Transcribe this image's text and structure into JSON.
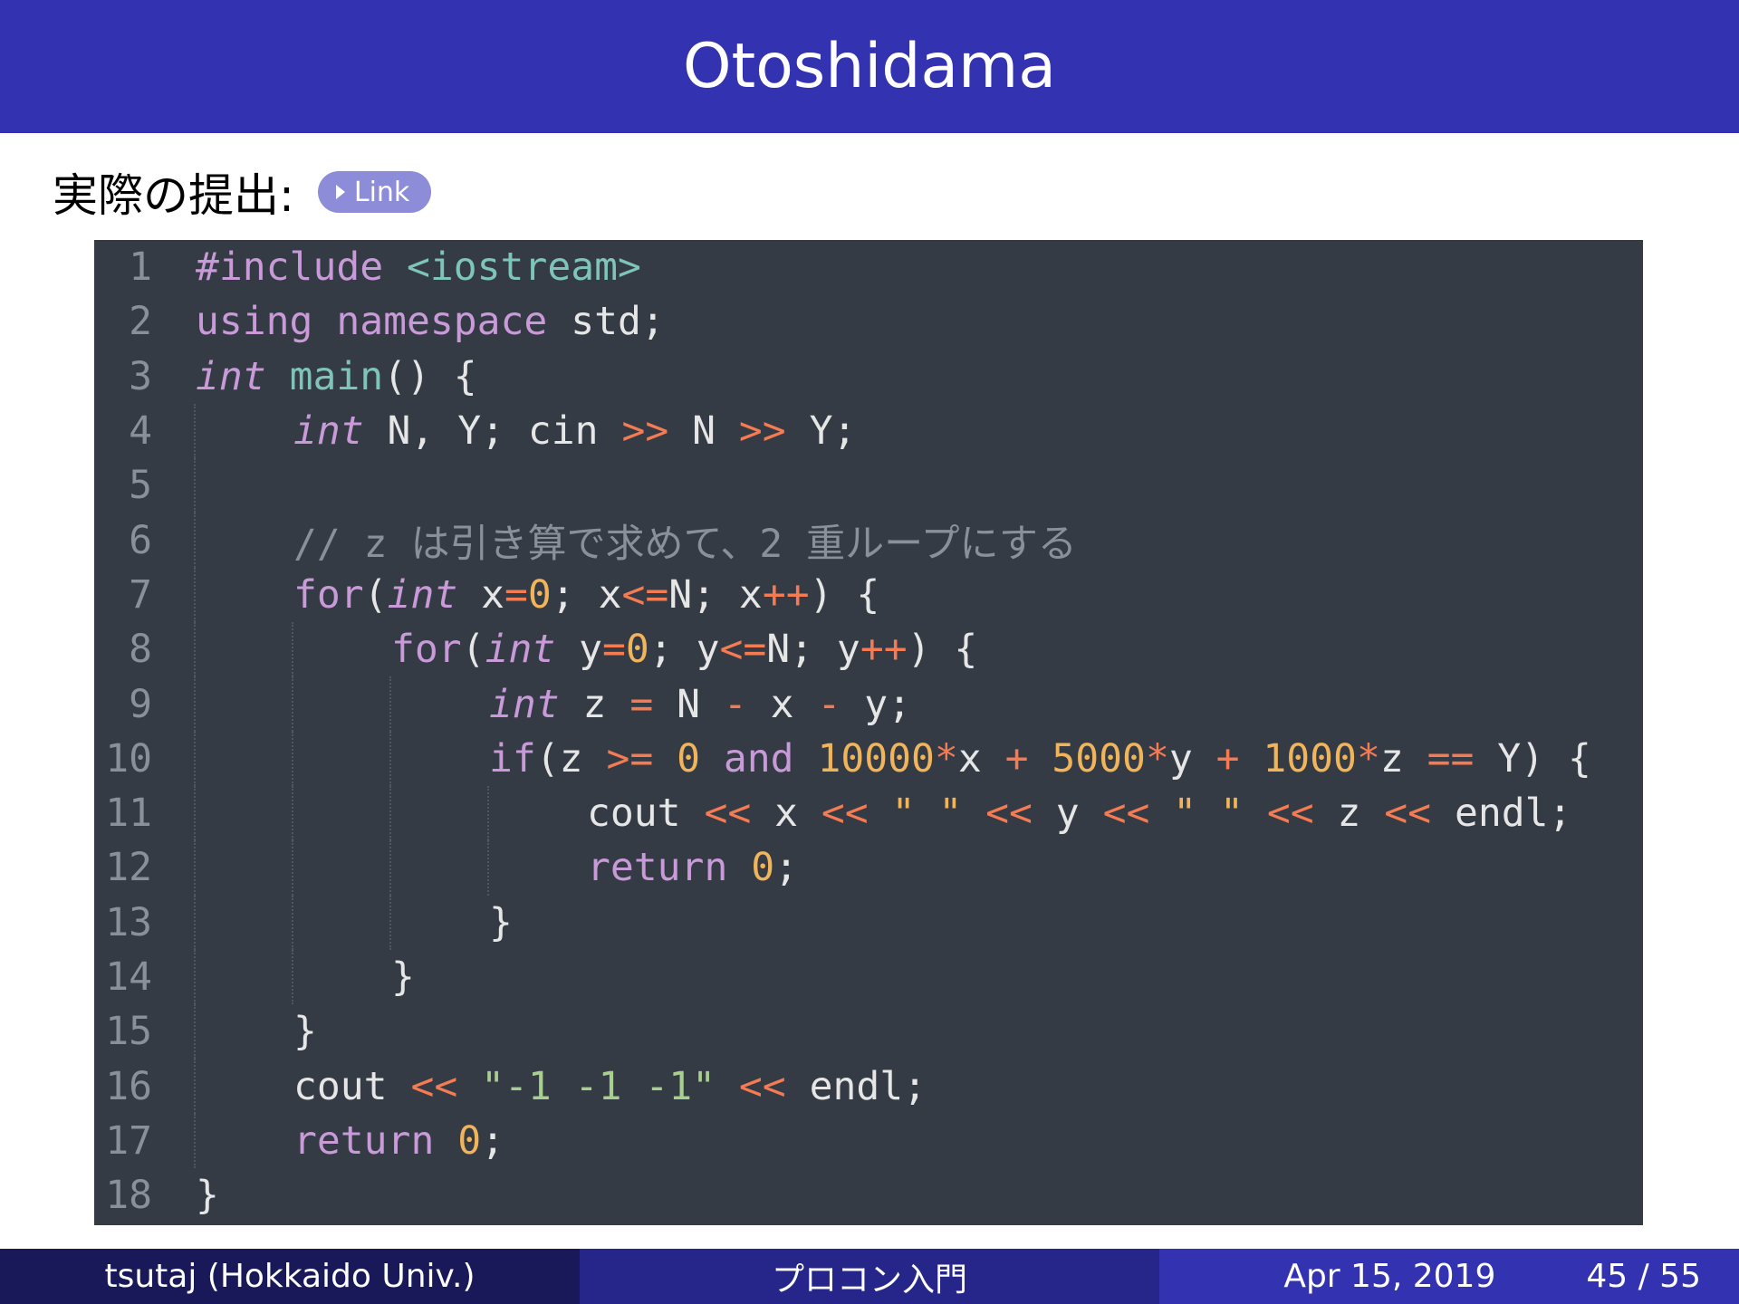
{
  "slide": {
    "title": "Otoshidama",
    "subtitle": "実際の提出:",
    "link_label": "Link"
  },
  "code": {
    "lines": [
      {
        "n": "1",
        "indent": 0,
        "tokens": [
          {
            "t": "#include ",
            "c": "kw"
          },
          {
            "t": "<iostream>",
            "c": "fn"
          }
        ]
      },
      {
        "n": "2",
        "indent": 0,
        "tokens": [
          {
            "t": "using namespace ",
            "c": "kw"
          },
          {
            "t": "std;",
            "c": "id"
          }
        ]
      },
      {
        "n": "3",
        "indent": 0,
        "tokens": [
          {
            "t": "int",
            "c": "type"
          },
          {
            "t": " ",
            "c": "id"
          },
          {
            "t": "main",
            "c": "fn"
          },
          {
            "t": "() {",
            "c": "id"
          }
        ]
      },
      {
        "n": "4",
        "indent": 1,
        "tokens": [
          {
            "t": "int",
            "c": "type"
          },
          {
            "t": " N, Y; cin ",
            "c": "id"
          },
          {
            "t": ">>",
            "c": "op"
          },
          {
            "t": " N ",
            "c": "id"
          },
          {
            "t": ">>",
            "c": "op"
          },
          {
            "t": " Y;",
            "c": "id"
          }
        ]
      },
      {
        "n": "5",
        "indent": 1,
        "tokens": []
      },
      {
        "n": "6",
        "indent": 1,
        "tokens": [
          {
            "t": "// z は引き算で求めて、2 重ループにする",
            "c": "cm"
          }
        ]
      },
      {
        "n": "7",
        "indent": 1,
        "tokens": [
          {
            "t": "for",
            "c": "kw"
          },
          {
            "t": "(",
            "c": "id"
          },
          {
            "t": "int",
            "c": "type"
          },
          {
            "t": " x",
            "c": "id"
          },
          {
            "t": "=",
            "c": "op"
          },
          {
            "t": "0",
            "c": "num"
          },
          {
            "t": "; x",
            "c": "id"
          },
          {
            "t": "<=",
            "c": "op"
          },
          {
            "t": "N; x",
            "c": "id"
          },
          {
            "t": "++",
            "c": "op"
          },
          {
            "t": ") {",
            "c": "id"
          }
        ]
      },
      {
        "n": "8",
        "indent": 2,
        "tokens": [
          {
            "t": "for",
            "c": "kw"
          },
          {
            "t": "(",
            "c": "id"
          },
          {
            "t": "int",
            "c": "type"
          },
          {
            "t": " y",
            "c": "id"
          },
          {
            "t": "=",
            "c": "op"
          },
          {
            "t": "0",
            "c": "num"
          },
          {
            "t": "; y",
            "c": "id"
          },
          {
            "t": "<=",
            "c": "op"
          },
          {
            "t": "N; y",
            "c": "id"
          },
          {
            "t": "++",
            "c": "op"
          },
          {
            "t": ") {",
            "c": "id"
          }
        ]
      },
      {
        "n": "9",
        "indent": 3,
        "tokens": [
          {
            "t": "int",
            "c": "type"
          },
          {
            "t": " z ",
            "c": "id"
          },
          {
            "t": "=",
            "c": "op"
          },
          {
            "t": " N ",
            "c": "id"
          },
          {
            "t": "-",
            "c": "op"
          },
          {
            "t": " x ",
            "c": "id"
          },
          {
            "t": "-",
            "c": "op"
          },
          {
            "t": " y;",
            "c": "id"
          }
        ]
      },
      {
        "n": "10",
        "indent": 3,
        "tokens": [
          {
            "t": "if",
            "c": "kw"
          },
          {
            "t": "(z ",
            "c": "id"
          },
          {
            "t": ">=",
            "c": "op"
          },
          {
            "t": " ",
            "c": "id"
          },
          {
            "t": "0",
            "c": "num"
          },
          {
            "t": " ",
            "c": "id"
          },
          {
            "t": "and",
            "c": "kw"
          },
          {
            "t": " ",
            "c": "id"
          },
          {
            "t": "10000",
            "c": "num"
          },
          {
            "t": "*",
            "c": "op"
          },
          {
            "t": "x ",
            "c": "id"
          },
          {
            "t": "+",
            "c": "op"
          },
          {
            "t": " ",
            "c": "id"
          },
          {
            "t": "5000",
            "c": "num"
          },
          {
            "t": "*",
            "c": "op"
          },
          {
            "t": "y ",
            "c": "id"
          },
          {
            "t": "+",
            "c": "op"
          },
          {
            "t": " ",
            "c": "id"
          },
          {
            "t": "1000",
            "c": "num"
          },
          {
            "t": "*",
            "c": "op"
          },
          {
            "t": "z ",
            "c": "id"
          },
          {
            "t": "==",
            "c": "op"
          },
          {
            "t": " Y) {",
            "c": "id"
          }
        ]
      },
      {
        "n": "11",
        "indent": 4,
        "tokens": [
          {
            "t": "cout ",
            "c": "id"
          },
          {
            "t": "<<",
            "c": "op"
          },
          {
            "t": " x ",
            "c": "id"
          },
          {
            "t": "<<",
            "c": "op"
          },
          {
            "t": " ",
            "c": "id"
          },
          {
            "t": "\" \"",
            "c": "num"
          },
          {
            "t": " ",
            "c": "id"
          },
          {
            "t": "<<",
            "c": "op"
          },
          {
            "t": " y ",
            "c": "id"
          },
          {
            "t": "<<",
            "c": "op"
          },
          {
            "t": " ",
            "c": "id"
          },
          {
            "t": "\" \"",
            "c": "num"
          },
          {
            "t": " ",
            "c": "id"
          },
          {
            "t": "<<",
            "c": "op"
          },
          {
            "t": " z ",
            "c": "id"
          },
          {
            "t": "<<",
            "c": "op"
          },
          {
            "t": " endl;",
            "c": "id"
          }
        ]
      },
      {
        "n": "12",
        "indent": 4,
        "tokens": [
          {
            "t": "return",
            "c": "kw"
          },
          {
            "t": " ",
            "c": "id"
          },
          {
            "t": "0",
            "c": "num"
          },
          {
            "t": ";",
            "c": "id"
          }
        ]
      },
      {
        "n": "13",
        "indent": 3,
        "tokens": [
          {
            "t": "}",
            "c": "id"
          }
        ]
      },
      {
        "n": "14",
        "indent": 2,
        "tokens": [
          {
            "t": "}",
            "c": "id"
          }
        ]
      },
      {
        "n": "15",
        "indent": 1,
        "tokens": [
          {
            "t": "}",
            "c": "id"
          }
        ]
      },
      {
        "n": "16",
        "indent": 1,
        "tokens": [
          {
            "t": "cout ",
            "c": "id"
          },
          {
            "t": "<<",
            "c": "op"
          },
          {
            "t": " ",
            "c": "id"
          },
          {
            "t": "\"-1 -1 -1\"",
            "c": "str"
          },
          {
            "t": " ",
            "c": "id"
          },
          {
            "t": "<<",
            "c": "op"
          },
          {
            "t": " endl;",
            "c": "id"
          }
        ]
      },
      {
        "n": "17",
        "indent": 1,
        "tokens": [
          {
            "t": "return",
            "c": "kw"
          },
          {
            "t": " ",
            "c": "id"
          },
          {
            "t": "0",
            "c": "num"
          },
          {
            "t": ";",
            "c": "id"
          }
        ]
      },
      {
        "n": "18",
        "indent": 0,
        "tokens": [
          {
            "t": "}",
            "c": "id"
          }
        ]
      }
    ]
  },
  "footer": {
    "author": "tsutaj  (Hokkaido Univ.)",
    "course": "プロコン入門",
    "date": "Apr 15, 2019",
    "page": "45 / 55"
  },
  "colors": {
    "title_bar": "#3333b2",
    "code_bg": "#343b45",
    "keyword": "#c99ad8",
    "operator": "#f47b52",
    "number": "#f0b45a",
    "function": "#7ec4b8",
    "string": "#a8cf90"
  }
}
